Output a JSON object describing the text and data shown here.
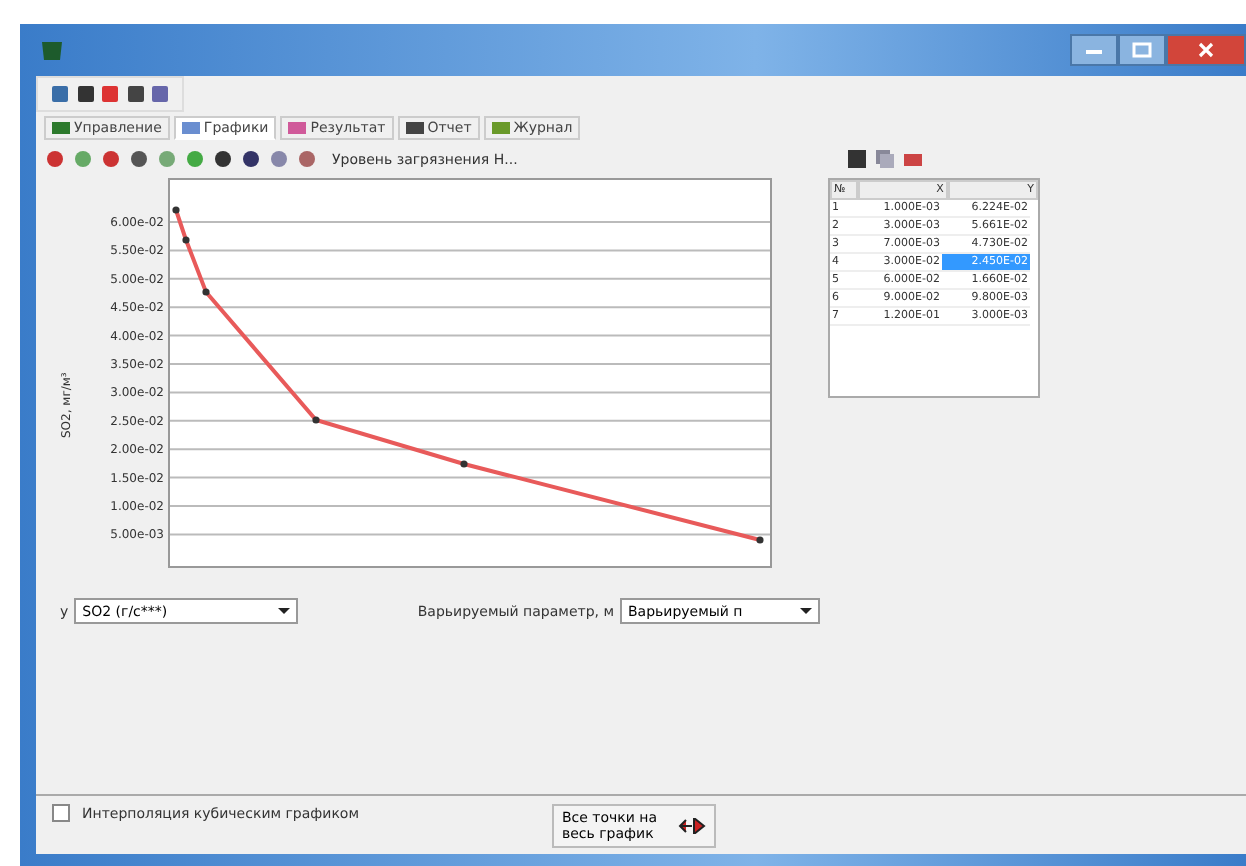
{
  "tabs": [
    {
      "label": "Управление",
      "selected": false
    },
    {
      "label": "Графики",
      "selected": true
    },
    {
      "label": "Результат",
      "selected": false
    },
    {
      "label": "Отчет",
      "selected": false
    },
    {
      "label": "Журнал",
      "selected": false
    }
  ],
  "toolbar": {
    "dropdown": "Уровень загрязнения Н..."
  },
  "chart": {
    "y_axis_title": "SO2, мг/м³",
    "y_tick_labels": [
      "6.00e-02",
      "5.50e-02",
      "5.00e-02",
      "4.50e-02",
      "4.00e-02",
      "3.50e-02",
      "3.00e-02",
      "2.50e-02",
      "2.00e-02",
      "1.50e-02",
      "1.00e-02",
      "5.00e-03"
    ]
  },
  "table": {
    "columns": [
      "№",
      "X",
      "Y"
    ],
    "rows": [
      {
        "cells": [
          "1",
          "1.000E-03",
          "6.224E-02"
        ],
        "selected": false
      },
      {
        "cells": [
          "2",
          "3.000E-03",
          "5.661E-02"
        ],
        "selected": false
      },
      {
        "cells": [
          "3",
          "7.000E-03",
          "4.730E-02"
        ],
        "selected": false
      },
      {
        "cells": [
          "4",
          "3.000E-02",
          "2.450E-02"
        ],
        "selected": true
      },
      {
        "cells": [
          "5",
          "6.000E-02",
          "1.660E-02"
        ],
        "selected": false
      },
      {
        "cells": [
          "6",
          "9.000E-02",
          "9.800E-03"
        ],
        "selected": false
      },
      {
        "cells": [
          "7",
          "1.200E-01",
          "3.000E-03"
        ],
        "selected": false
      }
    ]
  },
  "y_select": {
    "prefix": "y",
    "value": "SO2 (г/с***)"
  },
  "x_param": {
    "label": "Варьируемый параметр, м",
    "value": "Варьируемый п"
  },
  "interpolation": {
    "label": "Интерполяция кубическим графиком",
    "checked": false
  },
  "fit_button": {
    "label": "Все точки на весь график"
  }
}
